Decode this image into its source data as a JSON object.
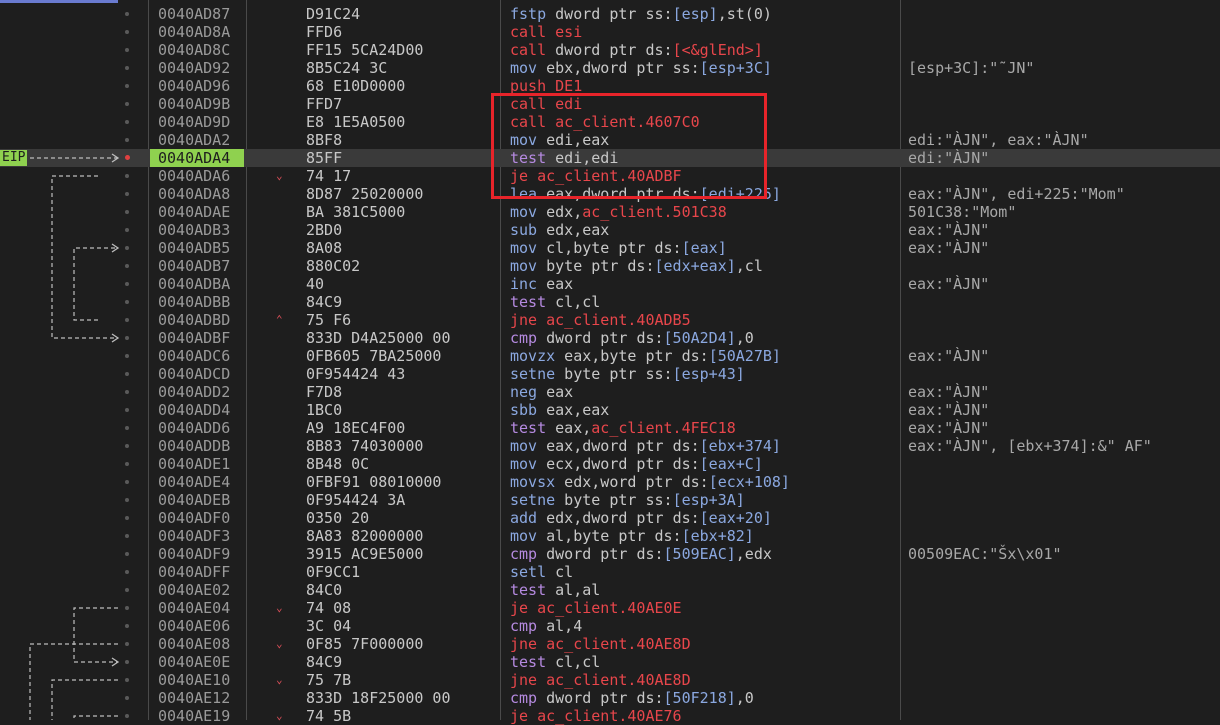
{
  "eip_label": "EIP",
  "colors": {
    "mnemonic_jump": "#e8464b",
    "mnemonic_mov": "#8ba8e0",
    "mnemonic_test": "#b58ae0",
    "register": "#e0e0e0",
    "segment": "#c8c8c8",
    "number": "#e0e0e0",
    "eip_bg": "#8fd14f",
    "highlight": "#e8242a"
  },
  "rows": [
    {
      "addr": "0040AD87",
      "bytes": "D91C24",
      "instr": [
        [
          "fstp",
          "#8ba8e0"
        ],
        [
          " dword ptr ",
          "#c8c8c8"
        ],
        [
          "ss:",
          "#c8c8c8"
        ],
        [
          "[esp]",
          "#8ba8e0"
        ],
        [
          ",st(0)",
          "#c8c8c8"
        ]
      ],
      "comment": ""
    },
    {
      "addr": "0040AD8A",
      "bytes": "FFD6",
      "instr": [
        [
          "call",
          "#e8464b"
        ],
        [
          " esi",
          "#e8464b"
        ]
      ],
      "comment": ""
    },
    {
      "addr": "0040AD8C",
      "bytes": "FF15 5CA24D00",
      "instr": [
        [
          "call",
          "#e8464b"
        ],
        [
          " dword ptr ",
          "#c8c8c8"
        ],
        [
          "ds:",
          "#c8c8c8"
        ],
        [
          "[<&glEnd>]",
          "#e8464b"
        ]
      ],
      "comment": ""
    },
    {
      "addr": "0040AD92",
      "bytes": "8B5C24 3C",
      "instr": [
        [
          "mov",
          "#8ba8e0"
        ],
        [
          " ebx,dword ptr ",
          "#c8c8c8"
        ],
        [
          "ss:",
          "#c8c8c8"
        ],
        [
          "[esp+3C]",
          "#8ba8e0"
        ]
      ],
      "comment": "[esp+3C]:\"˜JN\""
    },
    {
      "addr": "0040AD96",
      "bytes": "68 E10D0000",
      "instr": [
        [
          "push",
          "#e8464b"
        ],
        [
          " DE1",
          "#e8464b"
        ]
      ],
      "comment": ""
    },
    {
      "addr": "0040AD9B",
      "bytes": "FFD7",
      "instr": [
        [
          "call",
          "#e8464b"
        ],
        [
          " edi",
          "#e8464b"
        ]
      ],
      "comment": ""
    },
    {
      "addr": "0040AD9D",
      "bytes": "E8 1E5A0500",
      "instr": [
        [
          "call",
          "#e8464b"
        ],
        [
          " ac_client.4607C0",
          "#e8464b"
        ]
      ],
      "comment": ""
    },
    {
      "addr": "0040ADA2",
      "bytes": "8BF8",
      "instr": [
        [
          "mov",
          "#8ba8e0"
        ],
        [
          " edi,eax",
          "#c8c8c8"
        ]
      ],
      "comment": "edi:\"ÀJN\", eax:\"ÀJN\""
    },
    {
      "addr": "0040ADA4",
      "bytes": "85FF",
      "instr": [
        [
          "test",
          "#b58ae0"
        ],
        [
          " edi,edi",
          "#c8c8c8"
        ]
      ],
      "comment": "edi:\"ÀJN\"",
      "eip": true
    },
    {
      "addr": "0040ADA6",
      "bytes": "74 17",
      "instr": [
        [
          "je",
          "#e8464b"
        ],
        [
          " ac_client.40ADBF",
          "#e8464b"
        ]
      ],
      "comment": "",
      "arrow": "down"
    },
    {
      "addr": "0040ADA8",
      "bytes": "8D87 25020000",
      "instr": [
        [
          "lea",
          "#8ba8e0"
        ],
        [
          " eax,dword ptr ",
          "#c8c8c8"
        ],
        [
          "ds:",
          "#c8c8c8"
        ],
        [
          "[edi+225]",
          "#8ba8e0"
        ]
      ],
      "comment": "eax:\"ÀJN\", edi+225:\"Mom\""
    },
    {
      "addr": "0040ADAE",
      "bytes": "BA 381C5000",
      "instr": [
        [
          "mov",
          "#8ba8e0"
        ],
        [
          " edx,",
          "#c8c8c8"
        ],
        [
          "ac_client.501C38",
          "#e8464b"
        ]
      ],
      "comment": "501C38:\"Mom\""
    },
    {
      "addr": "0040ADB3",
      "bytes": "2BD0",
      "instr": [
        [
          "sub",
          "#8ba8e0"
        ],
        [
          " edx,eax",
          "#c8c8c8"
        ]
      ],
      "comment": "eax:\"ÀJN\""
    },
    {
      "addr": "0040ADB5",
      "bytes": "8A08",
      "instr": [
        [
          "mov",
          "#8ba8e0"
        ],
        [
          " cl,byte ptr ",
          "#c8c8c8"
        ],
        [
          "ds:",
          "#c8c8c8"
        ],
        [
          "[eax]",
          "#8ba8e0"
        ]
      ],
      "comment": "eax:\"ÀJN\""
    },
    {
      "addr": "0040ADB7",
      "bytes": "880C02",
      "instr": [
        [
          "mov",
          "#8ba8e0"
        ],
        [
          " byte ptr ",
          "#c8c8c8"
        ],
        [
          "ds:",
          "#c8c8c8"
        ],
        [
          "[edx+eax]",
          "#8ba8e0"
        ],
        [
          ",cl",
          "#c8c8c8"
        ]
      ],
      "comment": ""
    },
    {
      "addr": "0040ADBA",
      "bytes": "40",
      "instr": [
        [
          "inc",
          "#8ba8e0"
        ],
        [
          " eax",
          "#c8c8c8"
        ]
      ],
      "comment": "eax:\"ÀJN\""
    },
    {
      "addr": "0040ADBB",
      "bytes": "84C9",
      "instr": [
        [
          "test",
          "#b58ae0"
        ],
        [
          " cl,cl",
          "#c8c8c8"
        ]
      ],
      "comment": ""
    },
    {
      "addr": "0040ADBD",
      "bytes": "75 F6",
      "instr": [
        [
          "jne",
          "#e8464b"
        ],
        [
          " ac_client.40ADB5",
          "#e8464b"
        ]
      ],
      "comment": "",
      "arrow": "up"
    },
    {
      "addr": "0040ADBF",
      "bytes": "833D D4A25000 00",
      "instr": [
        [
          "cmp",
          "#b58ae0"
        ],
        [
          " dword ptr ",
          "#c8c8c8"
        ],
        [
          "ds:",
          "#c8c8c8"
        ],
        [
          "[50A2D4]",
          "#8ba8e0"
        ],
        [
          ",0",
          "#c8c8c8"
        ]
      ],
      "comment": ""
    },
    {
      "addr": "0040ADC6",
      "bytes": "0FB605 7BA25000",
      "instr": [
        [
          "movzx",
          "#8ba8e0"
        ],
        [
          " eax,byte ptr ",
          "#c8c8c8"
        ],
        [
          "ds:",
          "#c8c8c8"
        ],
        [
          "[50A27B]",
          "#8ba8e0"
        ]
      ],
      "comment": "eax:\"ÀJN\""
    },
    {
      "addr": "0040ADCD",
      "bytes": "0F954424 43",
      "instr": [
        [
          "setne",
          "#8ba8e0"
        ],
        [
          " byte ptr ",
          "#c8c8c8"
        ],
        [
          "ss:",
          "#c8c8c8"
        ],
        [
          "[esp+43]",
          "#8ba8e0"
        ]
      ],
      "comment": ""
    },
    {
      "addr": "0040ADD2",
      "bytes": "F7D8",
      "instr": [
        [
          "neg",
          "#8ba8e0"
        ],
        [
          " eax",
          "#c8c8c8"
        ]
      ],
      "comment": "eax:\"ÀJN\""
    },
    {
      "addr": "0040ADD4",
      "bytes": "1BC0",
      "instr": [
        [
          "sbb",
          "#8ba8e0"
        ],
        [
          " eax,eax",
          "#c8c8c8"
        ]
      ],
      "comment": "eax:\"ÀJN\""
    },
    {
      "addr": "0040ADD6",
      "bytes": "A9 18EC4F00",
      "instr": [
        [
          "test",
          "#b58ae0"
        ],
        [
          " eax,",
          "#c8c8c8"
        ],
        [
          "ac_client.4FEC18",
          "#e8464b"
        ]
      ],
      "comment": "eax:\"ÀJN\""
    },
    {
      "addr": "0040ADDB",
      "bytes": "8B83 74030000",
      "instr": [
        [
          "mov",
          "#8ba8e0"
        ],
        [
          " eax,dword ptr ",
          "#c8c8c8"
        ],
        [
          "ds:",
          "#c8c8c8"
        ],
        [
          "[ebx+374]",
          "#8ba8e0"
        ]
      ],
      "comment": "eax:\"ÀJN\", [ebx+374]:&\" AF\""
    },
    {
      "addr": "0040ADE1",
      "bytes": "8B48 0C",
      "instr": [
        [
          "mov",
          "#8ba8e0"
        ],
        [
          " ecx,dword ptr ",
          "#c8c8c8"
        ],
        [
          "ds:",
          "#c8c8c8"
        ],
        [
          "[eax+C]",
          "#8ba8e0"
        ]
      ],
      "comment": ""
    },
    {
      "addr": "0040ADE4",
      "bytes": "0FBF91 08010000",
      "instr": [
        [
          "movsx",
          "#8ba8e0"
        ],
        [
          " edx,word ptr ",
          "#c8c8c8"
        ],
        [
          "ds:",
          "#c8c8c8"
        ],
        [
          "[ecx+108]",
          "#8ba8e0"
        ]
      ],
      "comment": ""
    },
    {
      "addr": "0040ADEB",
      "bytes": "0F954424 3A",
      "instr": [
        [
          "setne",
          "#8ba8e0"
        ],
        [
          " byte ptr ",
          "#c8c8c8"
        ],
        [
          "ss:",
          "#c8c8c8"
        ],
        [
          "[esp+3A]",
          "#8ba8e0"
        ]
      ],
      "comment": ""
    },
    {
      "addr": "0040ADF0",
      "bytes": "0350 20",
      "instr": [
        [
          "add",
          "#8ba8e0"
        ],
        [
          " edx,dword ptr ",
          "#c8c8c8"
        ],
        [
          "ds:",
          "#c8c8c8"
        ],
        [
          "[eax+20]",
          "#8ba8e0"
        ]
      ],
      "comment": ""
    },
    {
      "addr": "0040ADF3",
      "bytes": "8A83 82000000",
      "instr": [
        [
          "mov",
          "#8ba8e0"
        ],
        [
          " al,byte ptr ",
          "#c8c8c8"
        ],
        [
          "ds:",
          "#c8c8c8"
        ],
        [
          "[ebx+82]",
          "#8ba8e0"
        ]
      ],
      "comment": ""
    },
    {
      "addr": "0040ADF9",
      "bytes": "3915 AC9E5000",
      "instr": [
        [
          "cmp",
          "#b58ae0"
        ],
        [
          " dword ptr ",
          "#c8c8c8"
        ],
        [
          "ds:",
          "#c8c8c8"
        ],
        [
          "[509EAC]",
          "#8ba8e0"
        ],
        [
          ",edx",
          "#c8c8c8"
        ]
      ],
      "comment": "00509EAC:\"Šx\\x01\""
    },
    {
      "addr": "0040ADFF",
      "bytes": "0F9CC1",
      "instr": [
        [
          "setl",
          "#8ba8e0"
        ],
        [
          " cl",
          "#c8c8c8"
        ]
      ],
      "comment": ""
    },
    {
      "addr": "0040AE02",
      "bytes": "84C0",
      "instr": [
        [
          "test",
          "#b58ae0"
        ],
        [
          " al,al",
          "#c8c8c8"
        ]
      ],
      "comment": ""
    },
    {
      "addr": "0040AE04",
      "bytes": "74 08",
      "instr": [
        [
          "je",
          "#e8464b"
        ],
        [
          " ac_client.40AE0E",
          "#e8464b"
        ]
      ],
      "comment": "",
      "arrow": "down"
    },
    {
      "addr": "0040AE06",
      "bytes": "3C 04",
      "instr": [
        [
          "cmp",
          "#b58ae0"
        ],
        [
          " al,4",
          "#c8c8c8"
        ]
      ],
      "comment": ""
    },
    {
      "addr": "0040AE08",
      "bytes": "0F85 7F000000",
      "instr": [
        [
          "jne",
          "#e8464b"
        ],
        [
          " ac_client.40AE8D",
          "#e8464b"
        ]
      ],
      "comment": "",
      "arrow": "down"
    },
    {
      "addr": "0040AE0E",
      "bytes": "84C9",
      "instr": [
        [
          "test",
          "#b58ae0"
        ],
        [
          " cl,cl",
          "#c8c8c8"
        ]
      ],
      "comment": ""
    },
    {
      "addr": "0040AE10",
      "bytes": "75 7B",
      "instr": [
        [
          "jne",
          "#e8464b"
        ],
        [
          " ac_client.40AE8D",
          "#e8464b"
        ]
      ],
      "comment": "",
      "arrow": "down"
    },
    {
      "addr": "0040AE12",
      "bytes": "833D 18F25000 00",
      "instr": [
        [
          "cmp",
          "#b58ae0"
        ],
        [
          " dword ptr ",
          "#c8c8c8"
        ],
        [
          "ds:",
          "#c8c8c8"
        ],
        [
          "[50F218]",
          "#8ba8e0"
        ],
        [
          ",0",
          "#c8c8c8"
        ]
      ],
      "comment": ""
    },
    {
      "addr": "0040AE19",
      "bytes": "74 5B",
      "instr": [
        [
          "je",
          "#e8464b"
        ],
        [
          " ac_client.40AE76",
          "#e8464b"
        ]
      ],
      "comment": "",
      "arrow": "down"
    }
  ]
}
